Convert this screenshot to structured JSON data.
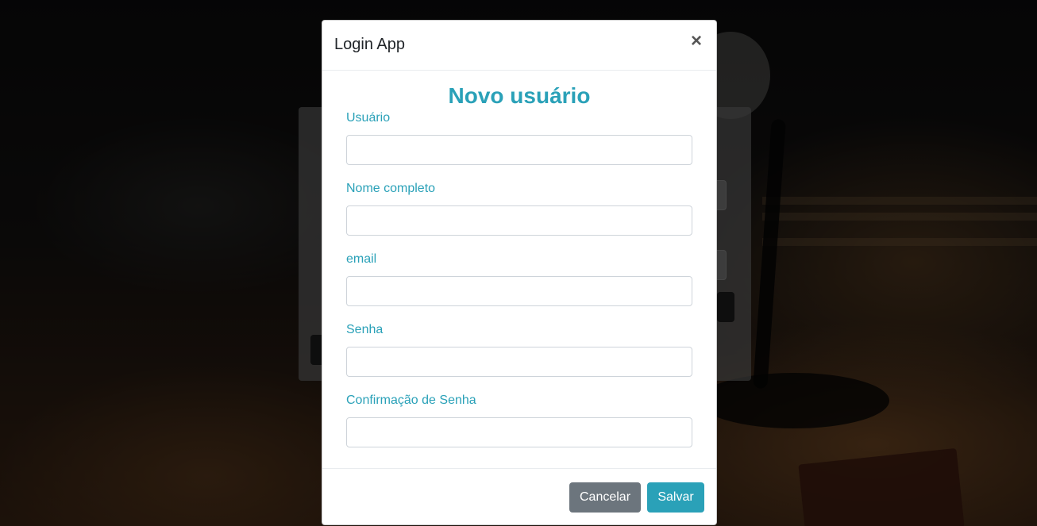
{
  "modal": {
    "title": "Login App",
    "close_glyph": "×",
    "heading": "Novo usuário",
    "fields": [
      {
        "label": "Usuário",
        "value": "",
        "placeholder": ""
      },
      {
        "label": "Nome completo",
        "value": "",
        "placeholder": ""
      },
      {
        "label": "email",
        "value": "",
        "placeholder": ""
      },
      {
        "label": "Senha",
        "value": "",
        "placeholder": ""
      },
      {
        "label": "Confirmação de Senha",
        "value": "",
        "placeholder": ""
      }
    ],
    "buttons": {
      "cancel": "Cancelar",
      "save": "Salvar"
    }
  },
  "colors": {
    "accent": "#2aa1b8",
    "cancel_button": "#6c757d",
    "overlay": "rgba(0,0,0,0.5)"
  },
  "icons": {
    "close": "close-icon"
  }
}
